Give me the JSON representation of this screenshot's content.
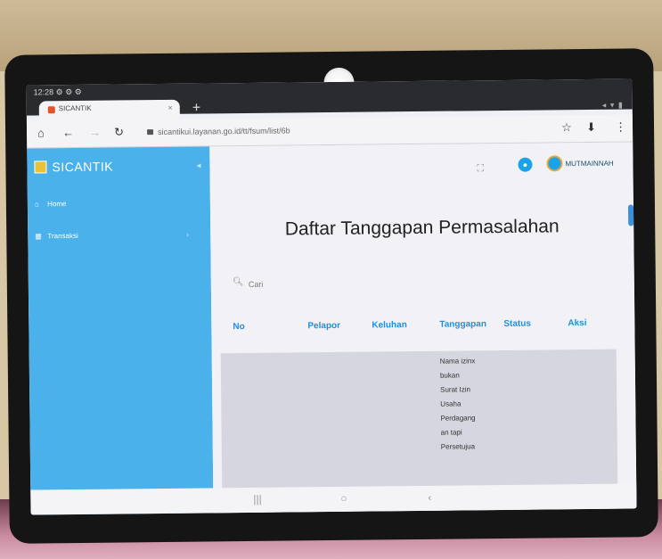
{
  "status_bar": {
    "time": "12:28",
    "indicators": "⚙ ⚙ ⚙",
    "right_icons": "◂ ▾ ▮"
  },
  "browser": {
    "tab_title": "SICANTIK",
    "tab_close": "×",
    "new_tab": "+",
    "url": "sicantikui.layanan.go.id/tt/fsum/list/6b",
    "icons": {
      "home": "home-icon",
      "back": "back-icon",
      "forward": "forward-icon",
      "reload": "reload-icon",
      "star": "star-icon",
      "download": "download-icon",
      "menu": "menu-icon"
    }
  },
  "sidebar": {
    "brand": "SICANTIK",
    "items": [
      {
        "label": "Home",
        "icon": "home-icon"
      },
      {
        "label": "Transaksi",
        "icon": "grid-icon"
      }
    ]
  },
  "header": {
    "user_name": "MUTMAINNAH"
  },
  "page": {
    "title": "Daftar Tanggapan Permasalahan",
    "search_placeholder": "Cari"
  },
  "table": {
    "columns": [
      "No",
      "Pelapor",
      "Keluhan",
      "Tanggapan",
      "Status",
      "Aksi"
    ],
    "rows": [
      {
        "no": "",
        "pelapor": "",
        "keluhan": "",
        "tanggapan_lines": [
          "Nama izinx",
          "bukan",
          "Surat Izin",
          "Usaha",
          "Perdagang",
          "an tapi",
          "Persetujua"
        ],
        "status": "",
        "aksi": ""
      }
    ]
  },
  "nav_bar": {
    "recents": "|||",
    "home": "○",
    "back": "‹"
  },
  "colors": {
    "sidebar": "#4ab1ea",
    "accent": "#1f8fe0",
    "row_bg": "#d5d6df"
  }
}
